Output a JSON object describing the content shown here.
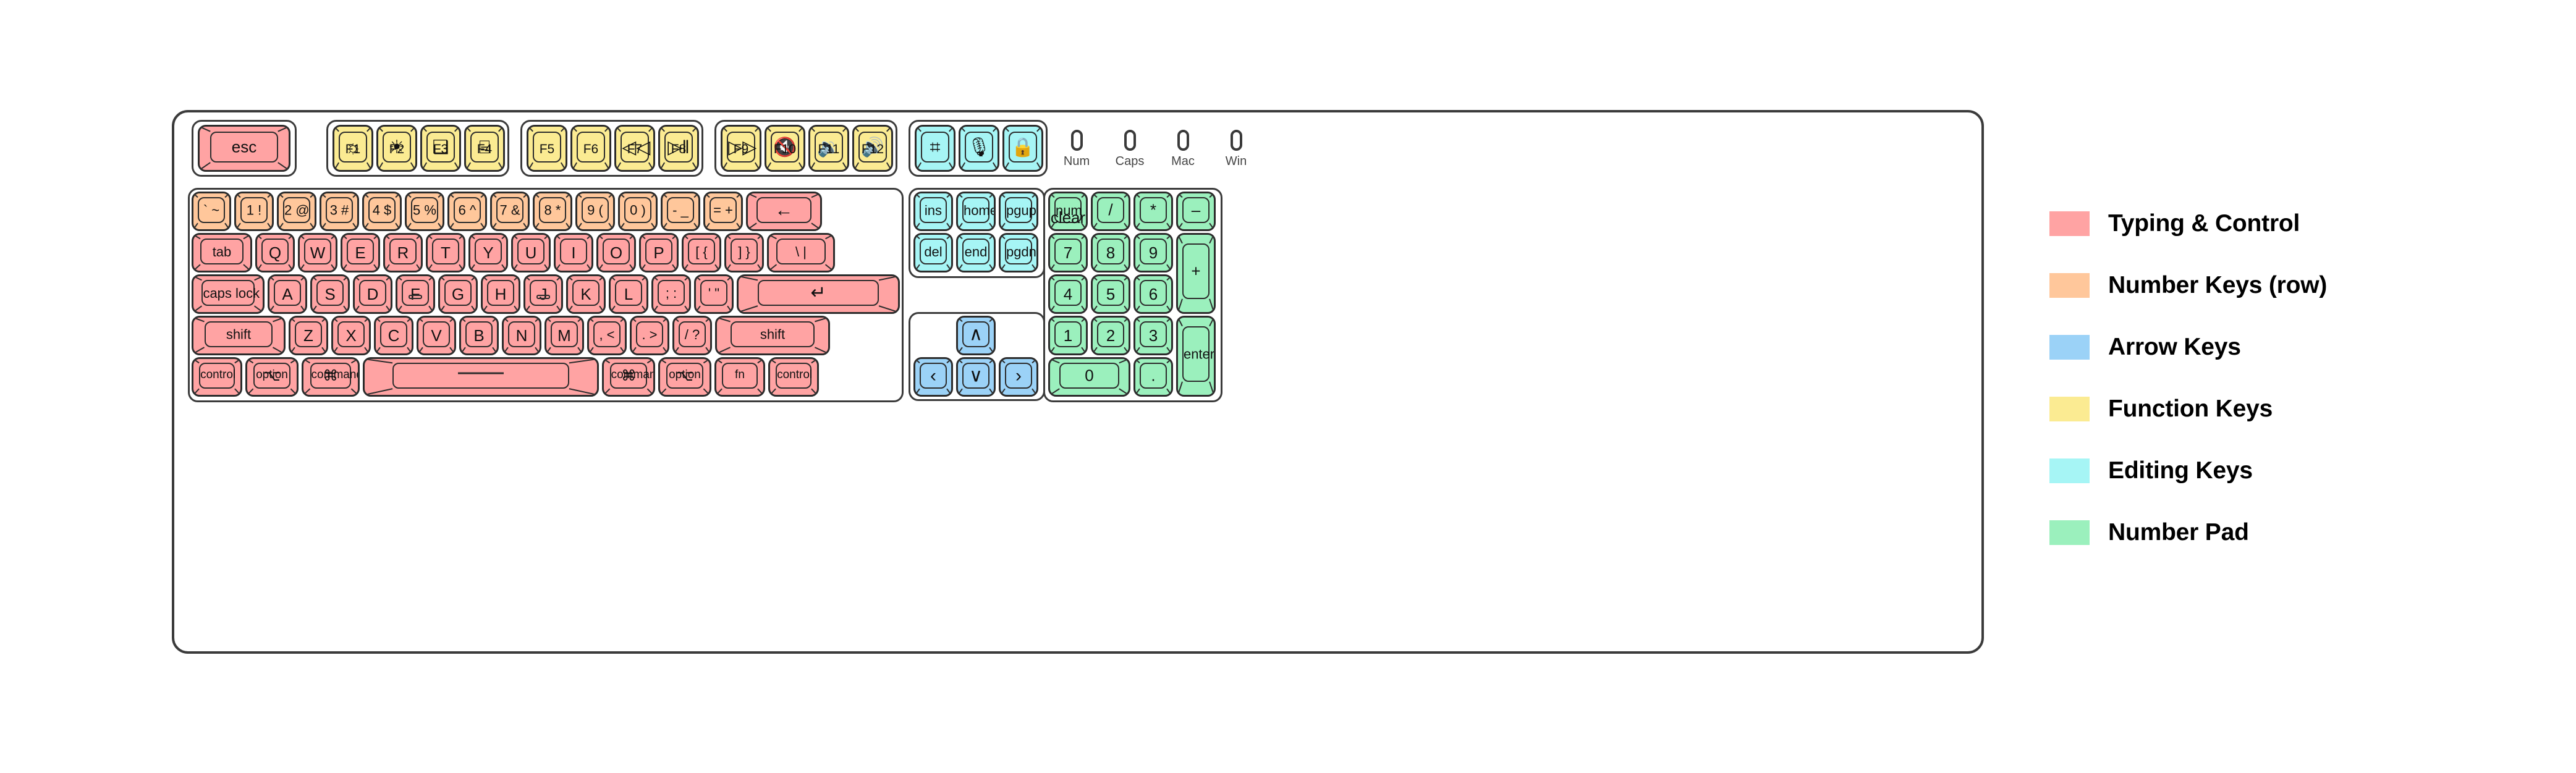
{
  "keyboard": {
    "name": "full-size-mac-keyboard-layout",
    "zones": {
      "typing": "#ffa3a3",
      "number_row": "#ffc79b",
      "arrow": "#9bd2f7",
      "function": "#fbeb92",
      "editing": "#a6f5f5",
      "numpad": "#9bf0bd"
    },
    "escape": {
      "label": "esc"
    },
    "function_row": [
      {
        "key": "F1",
        "icon": "☼",
        "icon_name": "brightness-down-icon"
      },
      {
        "key": "F2",
        "icon": "☀",
        "icon_name": "brightness-up-icon"
      },
      {
        "key": "F3",
        "icon": "❑",
        "icon_name": "mission-control-icon"
      },
      {
        "key": "F4",
        "icon": "⌸",
        "icon_name": "launchpad-icon"
      },
      {
        "key": "F5",
        "icon": "",
        "icon_name": "none"
      },
      {
        "key": "F6",
        "icon": "",
        "icon_name": "none"
      },
      {
        "key": "F7",
        "icon": "◁◁",
        "icon_name": "rewind-icon"
      },
      {
        "key": "F8",
        "icon": "▷‖",
        "icon_name": "play-pause-icon"
      },
      {
        "key": "F9",
        "icon": "▷▷",
        "icon_name": "fast-forward-icon"
      },
      {
        "key": "F10",
        "icon": "🔇",
        "icon_name": "mute-icon"
      },
      {
        "key": "F11",
        "icon": "🔉",
        "icon_name": "volume-down-icon"
      },
      {
        "key": "F12",
        "icon": "🔊",
        "icon_name": "volume-up-icon"
      }
    ],
    "utility_keys": [
      {
        "icon": "⌗",
        "icon_name": "screenshot-crop-icon"
      },
      {
        "icon": "🎙",
        "icon_name": "microphone-icon"
      },
      {
        "icon": "🔒",
        "icon_name": "lock-icon"
      }
    ],
    "indicators": [
      {
        "label": "Num",
        "state": "off"
      },
      {
        "label": "Caps",
        "state": "off"
      },
      {
        "label": "Mac",
        "state": "off"
      },
      {
        "label": "Win",
        "state": "off"
      }
    ],
    "number_row": [
      {
        "label": "` ~"
      },
      {
        "label": "1 !"
      },
      {
        "label": "2 @"
      },
      {
        "label": "3 #"
      },
      {
        "label": "4 $"
      },
      {
        "label": "5 %"
      },
      {
        "label": "6 ^"
      },
      {
        "label": "7 &"
      },
      {
        "label": "8 *"
      },
      {
        "label": "9 ("
      },
      {
        "label": "0 )"
      },
      {
        "label": "- _"
      },
      {
        "label": "= +"
      }
    ],
    "backspace": {
      "label": "←"
    },
    "qwerty_row": [
      {
        "label": "tab"
      },
      {
        "label": "Q"
      },
      {
        "label": "W"
      },
      {
        "label": "E"
      },
      {
        "label": "R"
      },
      {
        "label": "T"
      },
      {
        "label": "Y"
      },
      {
        "label": "U"
      },
      {
        "label": "I"
      },
      {
        "label": "O"
      },
      {
        "label": "P"
      },
      {
        "label": "[ {"
      },
      {
        "label": "] }"
      },
      {
        "label": "\\ |"
      }
    ],
    "home_row": [
      {
        "label": "caps lock"
      },
      {
        "label": "A"
      },
      {
        "label": "S"
      },
      {
        "label": "D"
      },
      {
        "label": "F",
        "homing": true
      },
      {
        "label": "G"
      },
      {
        "label": "H"
      },
      {
        "label": "J",
        "homing": true
      },
      {
        "label": "K"
      },
      {
        "label": "L"
      },
      {
        "label": "; :"
      },
      {
        "label": "' \""
      }
    ],
    "return": {
      "label": "↵"
    },
    "shift_row": [
      {
        "label": "shift"
      },
      {
        "label": "Z"
      },
      {
        "label": "X"
      },
      {
        "label": "C"
      },
      {
        "label": "V"
      },
      {
        "label": "B"
      },
      {
        "label": "N"
      },
      {
        "label": "M"
      },
      {
        "label": ", <"
      },
      {
        "label": ". >"
      },
      {
        "label": "/ ?"
      },
      {
        "label": "shift"
      }
    ],
    "bottom_row": [
      {
        "label": "control",
        "sub": ""
      },
      {
        "label": "option",
        "sub": "⌥"
      },
      {
        "label": "command",
        "sub": "⌘"
      },
      {
        "label": "",
        "sub": "",
        "name": "spacebar"
      },
      {
        "label": "command",
        "sub": "⌘"
      },
      {
        "label": "option",
        "sub": "⌥"
      },
      {
        "label": "fn",
        "sub": ""
      },
      {
        "label": "control",
        "sub": ""
      }
    ],
    "nav_cluster": [
      {
        "label": "ins"
      },
      {
        "label": "home"
      },
      {
        "label": "pgup"
      },
      {
        "label": "del"
      },
      {
        "label": "end"
      },
      {
        "label": "pgdn"
      }
    ],
    "arrow_cluster": [
      {
        "label": "∧",
        "name": "arrow-up-key"
      },
      {
        "label": "‹",
        "name": "arrow-left-key"
      },
      {
        "label": "∨",
        "name": "arrow-down-key"
      },
      {
        "label": "›",
        "name": "arrow-right-key"
      }
    ],
    "numpad": {
      "num_clear": {
        "line1": "num",
        "line2": "clear"
      },
      "divide": "/",
      "multiply": "*",
      "minus": "–",
      "row7": [
        "7",
        "8",
        "9"
      ],
      "plus": "+",
      "row4": [
        "4",
        "5",
        "6"
      ],
      "row1": [
        "1",
        "2",
        "3"
      ],
      "zero": "0",
      "decimal": ".",
      "enter": "enter"
    }
  },
  "legend": {
    "title": "key-zone-legend",
    "items": [
      {
        "color": "#ffa3a3",
        "label": "Typing & Control"
      },
      {
        "color": "#ffc79b",
        "label": "Number Keys (row)"
      },
      {
        "color": "#9bd2f7",
        "label": "Arrow Keys"
      },
      {
        "color": "#fbeb92",
        "label": "Function Keys"
      },
      {
        "color": "#a6f5f5",
        "label": "Editing Keys"
      },
      {
        "color": "#9bf0bd",
        "label": "Number Pad"
      }
    ]
  }
}
